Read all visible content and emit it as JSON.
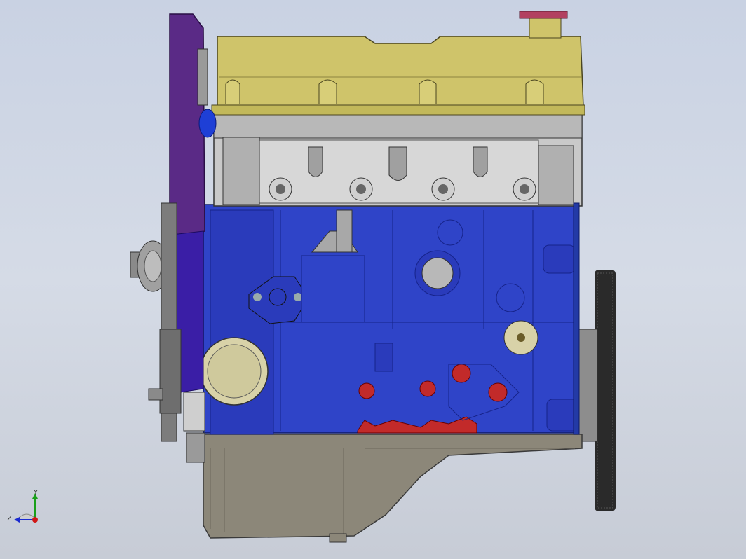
{
  "viewport": {
    "background_top": "#c9d2e3",
    "background_bottom": "#c7ccd6"
  },
  "model": {
    "colors": {
      "valve_cover": "#cfc46a",
      "cylinder_head": "#c9c9c9",
      "engine_block": "#2f44c8",
      "timing_cover": "#5a2a86",
      "oil_pan": "#8c8779",
      "flywheel": "#2a2a2a",
      "mount_bosses": "#c22a2a",
      "oil_filter": "#d8d2a8",
      "filler_cap": "#b24060"
    }
  },
  "triad": {
    "y_label": "Y",
    "z_label": "Z",
    "y_color": "#1aa01a",
    "z_color": "#1a2ad0",
    "origin_color": "#d01818"
  }
}
